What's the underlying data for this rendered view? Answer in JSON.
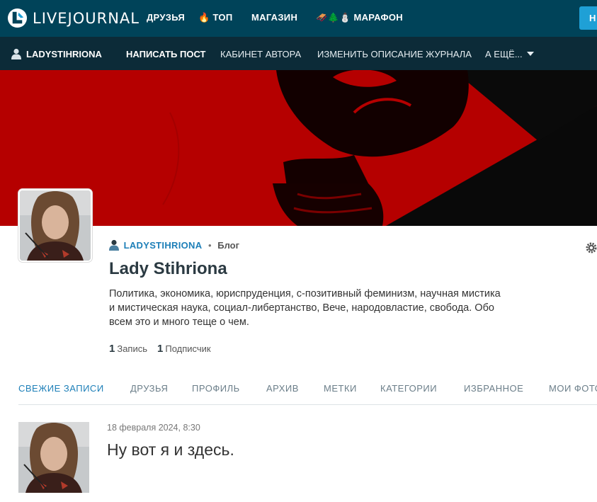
{
  "topbar": {
    "logo_text": "LIVEJOURNAL",
    "nav": {
      "friends": "ДРУЗЬЯ",
      "top_emoji": "🔥",
      "top": "ТОП",
      "shop": "МАГАЗИН",
      "marathon_emoji": "🛷🌲⛄",
      "marathon": "МАРАФОН"
    },
    "login_label": "Н"
  },
  "subbar": {
    "username": "LADYSTIHRIONA",
    "write_post": "НАПИСАТЬ ПОСТ",
    "author_cabinet": "КАБИНЕТ АВТОРА",
    "edit_description": "ИЗМЕНИТЬ ОПИСАНИЕ ЖУРНАЛА",
    "more": "А ЕЩЁ..."
  },
  "journal": {
    "username": "LADYSTIHRIONA",
    "separator": "•",
    "type": "Блог",
    "title": "Lady Stihriona",
    "description": "Политика, экономика, юриспруденция, с-позитивный феминизм, научная мистика и мистическая наука, социал-либертанство, Вече, народовластие, свобода. Обо всем это и много теще о чем.",
    "stats": {
      "posts_count": "1",
      "posts_label": "Запись",
      "subscribers_count": "1",
      "subscribers_label": "Подписчик"
    }
  },
  "tabs": [
    {
      "label": "СВЕЖИЕ ЗАПИСИ",
      "active": true
    },
    {
      "label": "ДРУЗЬЯ",
      "active": false
    },
    {
      "label": "ПРОФИЛЬ",
      "active": false
    },
    {
      "label": "АРХИВ",
      "active": false
    },
    {
      "label": "МЕТКИ",
      "active": false
    },
    {
      "label": "КАТЕГОРИИ",
      "active": false
    },
    {
      "label": "ИЗБРАННОЕ",
      "active": false
    },
    {
      "label": "МОИ ФОТО",
      "active": false
    }
  ],
  "post": {
    "date": "18 февраля 2024, 8:30",
    "title": "Ну вот я и здесь."
  },
  "colors": {
    "topbar": "#004359",
    "subbar": "#0c2b38",
    "accent": "#1d7fb8",
    "banner_red": "#b60000",
    "login_button": "#1fa0d6"
  }
}
